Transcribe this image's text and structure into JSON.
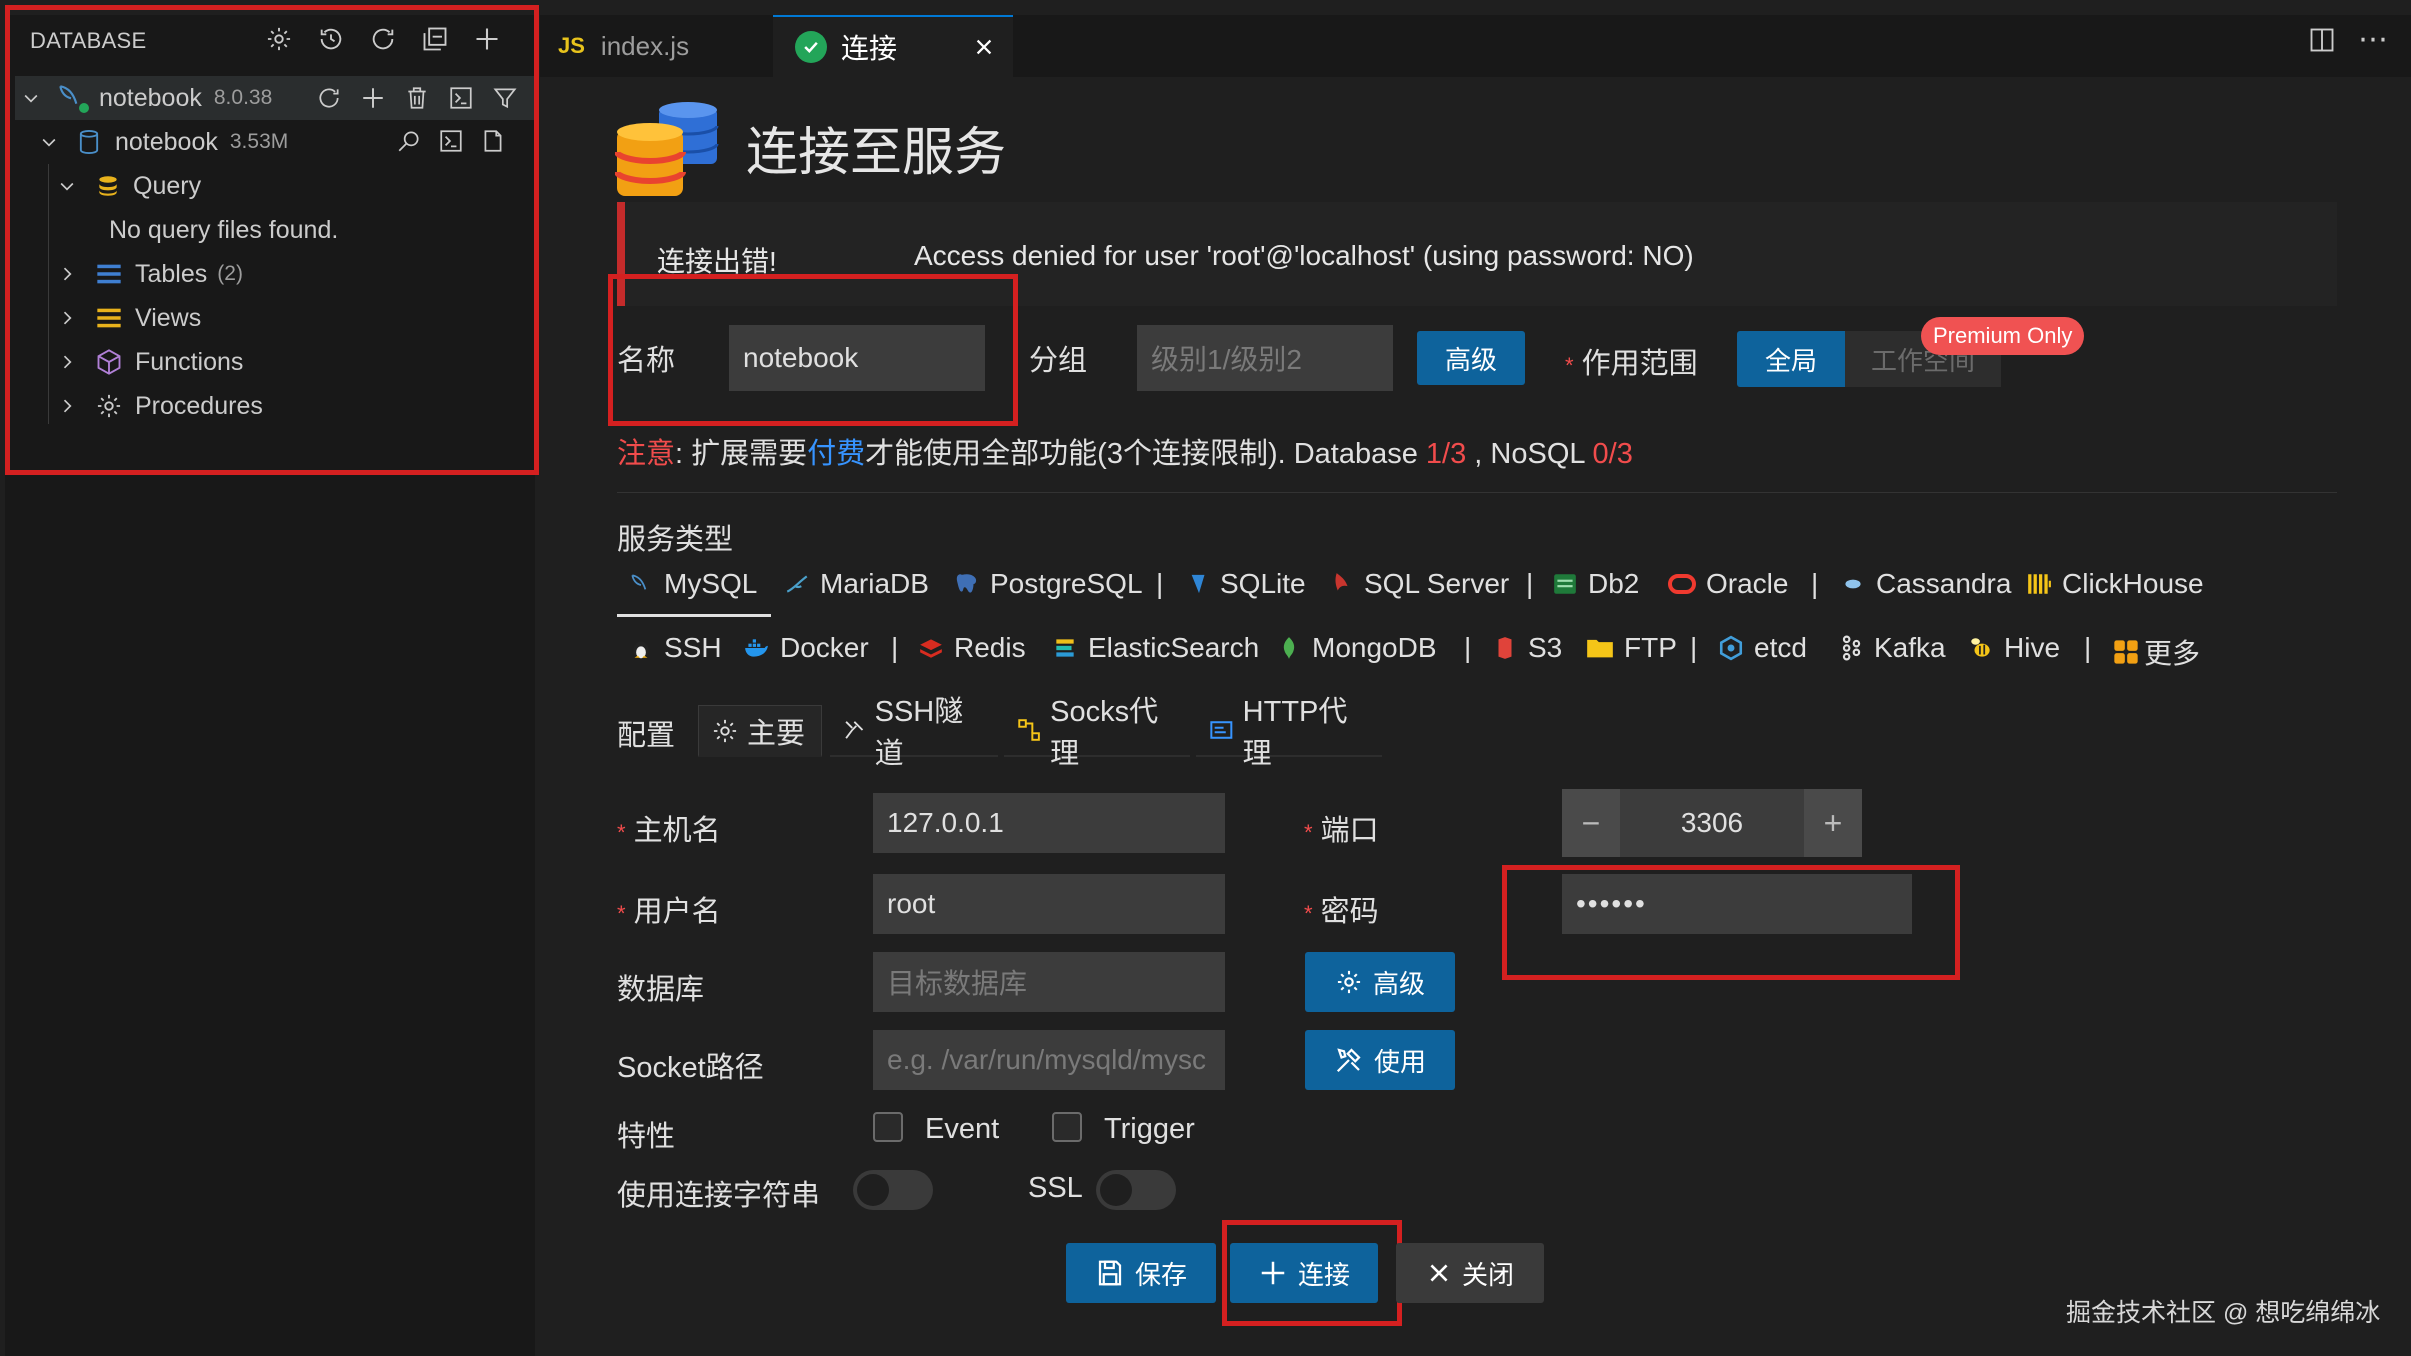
{
  "sidebar": {
    "title": "DATABASE",
    "header_icons": [
      "gear-icon",
      "history-icon",
      "refresh-icon",
      "collapse-icon",
      "add-icon"
    ],
    "connection": {
      "name": "notebook",
      "version": "8.0.38"
    },
    "database": {
      "name": "notebook",
      "size": "3.53M"
    },
    "query": {
      "label": "Query",
      "empty_text": "No query files found."
    },
    "items": [
      {
        "label": "Tables",
        "count": "(2)"
      },
      {
        "label": "Views",
        "count": ""
      },
      {
        "label": "Functions",
        "count": ""
      },
      {
        "label": "Procedures",
        "count": ""
      }
    ]
  },
  "tabs": {
    "file_tab": {
      "badge": "JS",
      "label": "index.js"
    },
    "active_tab": {
      "label": "连接"
    }
  },
  "main": {
    "title": "连接至服务",
    "error": {
      "label": "连接出错!",
      "message": "Access denied for user 'root'@'localhost' (using password: NO)"
    },
    "name": {
      "label": "名称",
      "value": "notebook"
    },
    "group": {
      "label": "分组",
      "placeholder": "级别1/级别2"
    },
    "advanced_button": "高级",
    "scope": {
      "label": "作用范围",
      "global": "全局",
      "workspace": "工作空间",
      "badge": "Premium Only"
    },
    "notice": {
      "prefix": "注意",
      "text1": ": 扩展需要",
      "link": "付费",
      "text2": "才能使用全部功能(3个连接限制). Database ",
      "db_count": "1/3",
      "text3": " , NoSQL ",
      "nosql_count": "0/3"
    },
    "service_type_label": "服务类型",
    "services_row1": [
      "MySQL",
      "MariaDB",
      "PostgreSQL",
      "SQLite",
      "SQL Server",
      "Db2",
      "Oracle",
      "Cassandra",
      "ClickHouse"
    ],
    "services_row2": [
      "SSH",
      "Docker",
      "Redis",
      "ElasticSearch",
      "MongoDB",
      "S3",
      "FTP",
      "etcd",
      "Kafka",
      "Hive",
      "更多"
    ],
    "config_label": "配置",
    "config_tabs": [
      "主要",
      "SSH隧道",
      "Socks代理",
      "HTTP代理"
    ],
    "host": {
      "label": "主机名",
      "value": "127.0.0.1"
    },
    "port": {
      "label": "端口",
      "value": "3306"
    },
    "user": {
      "label": "用户名",
      "value": "root"
    },
    "password": {
      "label": "密码",
      "value": "••••••"
    },
    "database": {
      "label": "数据库",
      "placeholder": "目标数据库"
    },
    "db_advanced": "高级",
    "socket": {
      "label": "Socket路径",
      "placeholder": "e.g. /var/run/mysqld/mysc"
    },
    "use_button": "使用",
    "features": {
      "label": "特性",
      "event": "Event",
      "trigger": "Trigger"
    },
    "conn_string_label": "使用连接字符串",
    "ssl_label": "SSL",
    "save_button": "保存",
    "connect_button": "连接",
    "close_button": "关闭"
  },
  "watermark": "掘金技术社区 @ 想吃绵绵冰",
  "colors": {
    "accent": "#0e639c",
    "error": "#f14c4c",
    "outline": "#d42020",
    "success": "#23a559"
  }
}
